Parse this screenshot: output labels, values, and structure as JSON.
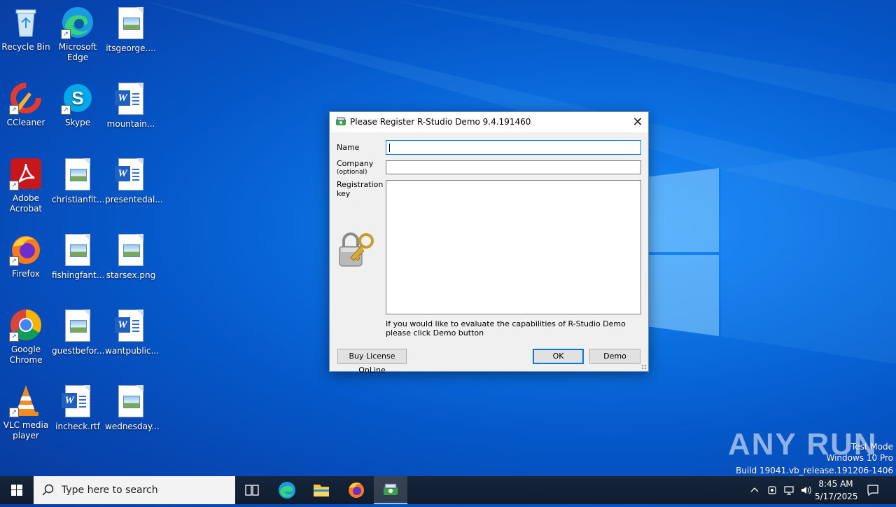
{
  "desktop": {
    "icons": [
      {
        "label": "Recycle Bin"
      },
      {
        "label": "Microsoft Edge"
      },
      {
        "label": "itsgeorge...."
      },
      {
        "label": "CCleaner"
      },
      {
        "label": "Skype"
      },
      {
        "label": "mountain..."
      },
      {
        "label": "Adobe Acrobat"
      },
      {
        "label": "christianfit..."
      },
      {
        "label": "presentedal..."
      },
      {
        "label": "Firefox"
      },
      {
        "label": "fishingfant..."
      },
      {
        "label": "starsex.png"
      },
      {
        "label": "Google Chrome"
      },
      {
        "label": "guestbefor..."
      },
      {
        "label": "wantpublic..."
      },
      {
        "label": "VLC media player"
      },
      {
        "label": "incheck.rtf"
      },
      {
        "label": "wednesday..."
      }
    ]
  },
  "dialog": {
    "title": "Please Register R-Studio Demo 9.4.191460",
    "name_label": "Name",
    "name_value": "",
    "company_label": "Company",
    "company_optional": "(optional)",
    "company_value": "",
    "regkey_label_1": "Registration",
    "regkey_label_2": "key",
    "regkey_value": "",
    "info_text": "If you would like to evaluate the capabilities of R-Studio Demo please click Demo button",
    "buy_label": "Buy License OnLine",
    "ok_label": "OK",
    "demo_label": "Demo"
  },
  "watermark": {
    "brand": "ANY RUN",
    "test_mode": "Test Mode",
    "edition": "Windows 10 Pro",
    "build": "Build 19041.vb_release.191206-1406"
  },
  "taskbar": {
    "search_placeholder": "Type here to search",
    "time": "8:45 AM",
    "date": "5/17/2025"
  },
  "colors": {
    "accent": "#0078d7",
    "taskbar": "#101c2e"
  }
}
